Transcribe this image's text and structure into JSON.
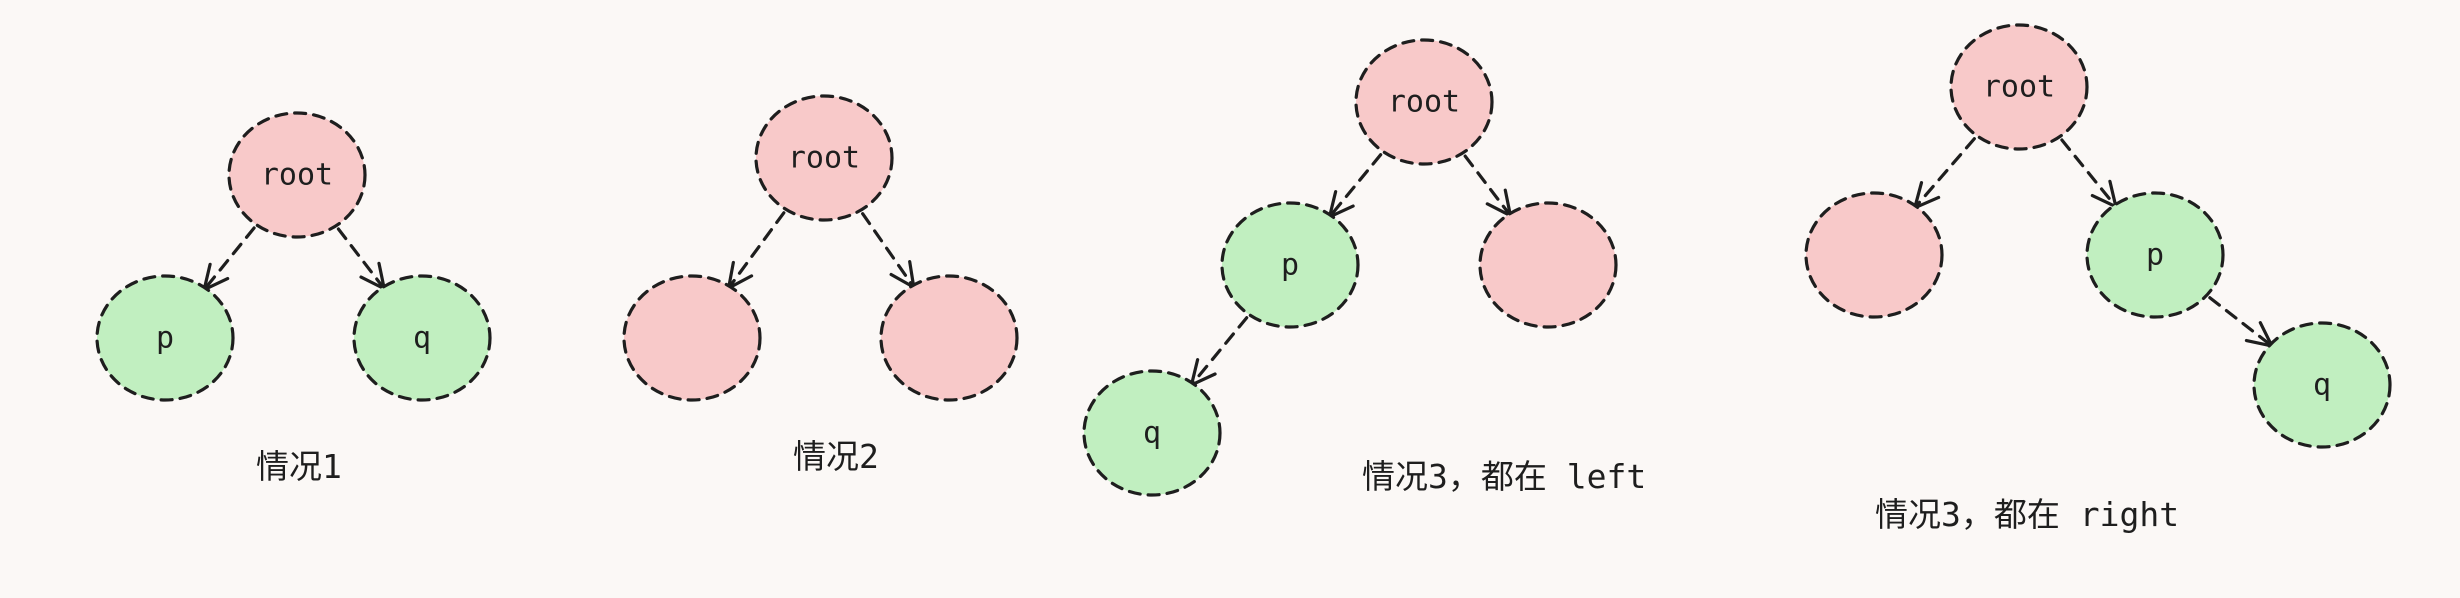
{
  "colors": {
    "background": "#fbf8f6",
    "root_fill": "#f8c9c9",
    "pq_fill": "#c1efc0",
    "empty_fill": "#f8c9c9",
    "stroke": "#1e1e1e"
  },
  "diagrams": [
    {
      "caption": "情况1",
      "nodes": [
        {
          "id": "root",
          "label": "root",
          "kind": "root"
        },
        {
          "id": "p",
          "label": "p",
          "kind": "target"
        },
        {
          "id": "q",
          "label": "q",
          "kind": "target"
        }
      ],
      "edges": [
        [
          "root",
          "p"
        ],
        [
          "root",
          "q"
        ]
      ]
    },
    {
      "caption": "情况2",
      "nodes": [
        {
          "id": "root",
          "label": "root",
          "kind": "root"
        },
        {
          "id": "left",
          "label": "",
          "kind": "empty"
        },
        {
          "id": "right",
          "label": "",
          "kind": "empty"
        }
      ],
      "edges": [
        [
          "root",
          "left"
        ],
        [
          "root",
          "right"
        ]
      ]
    },
    {
      "caption": "情况3，都在 left",
      "nodes": [
        {
          "id": "root",
          "label": "root",
          "kind": "root"
        },
        {
          "id": "p",
          "label": "p",
          "kind": "target"
        },
        {
          "id": "right",
          "label": "",
          "kind": "empty"
        },
        {
          "id": "q",
          "label": "q",
          "kind": "target"
        }
      ],
      "edges": [
        [
          "root",
          "p"
        ],
        [
          "root",
          "right"
        ],
        [
          "p",
          "q"
        ]
      ]
    },
    {
      "caption": "情况3，都在 right",
      "nodes": [
        {
          "id": "root",
          "label": "root",
          "kind": "root"
        },
        {
          "id": "left",
          "label": "",
          "kind": "empty"
        },
        {
          "id": "p",
          "label": "p",
          "kind": "target"
        },
        {
          "id": "q",
          "label": "q",
          "kind": "target"
        }
      ],
      "edges": [
        [
          "root",
          "left"
        ],
        [
          "root",
          "p"
        ],
        [
          "p",
          "q"
        ]
      ]
    }
  ]
}
